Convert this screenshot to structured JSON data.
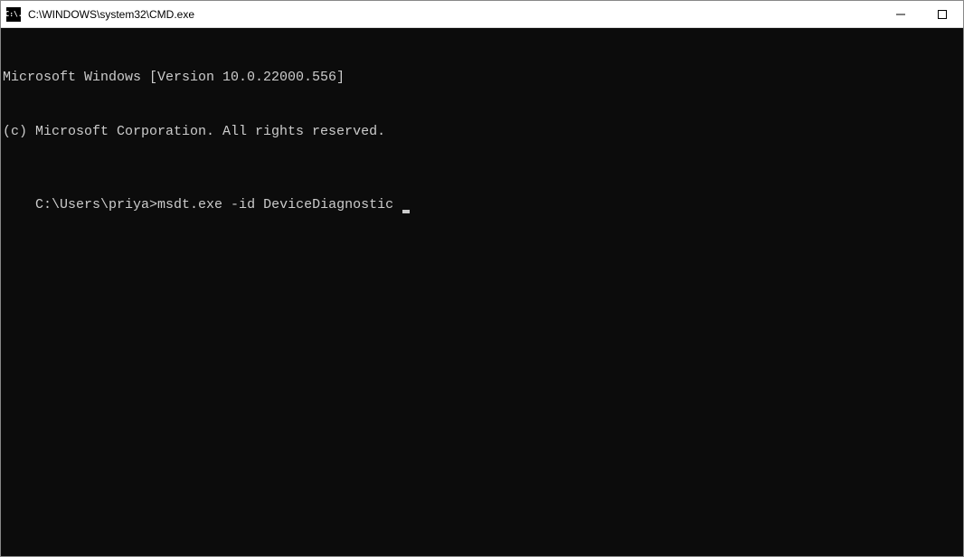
{
  "window": {
    "title": "C:\\WINDOWS\\system32\\CMD.exe",
    "icon_label": "C:\\."
  },
  "terminal": {
    "line1": "Microsoft Windows [Version 10.0.22000.556]",
    "line2": "(c) Microsoft Corporation. All rights reserved.",
    "blank": "",
    "prompt": "C:\\Users\\priya>",
    "command": "msdt.exe -id DeviceDiagnostic "
  }
}
